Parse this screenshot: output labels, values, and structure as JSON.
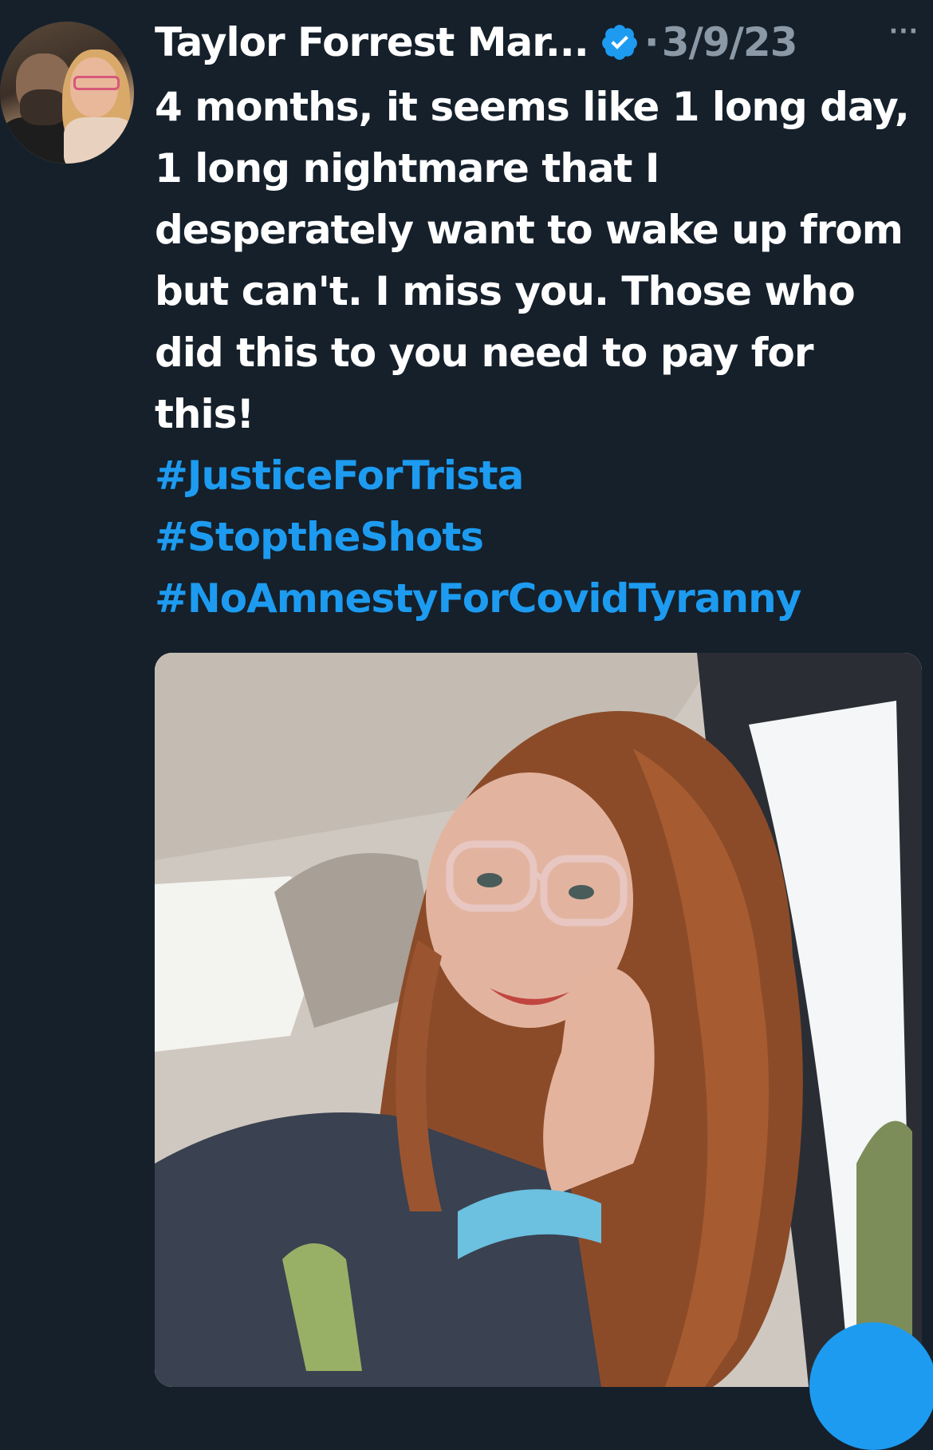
{
  "tweet": {
    "author_name": "Taylor Forrest Mar...",
    "separator": "·",
    "date": "3/9/23",
    "more_label": "···",
    "text": "4 months, it seems like 1 long day, 1 long nightmare that I desperately want to wake up from but can't. I miss you. Those who did this to you need to pay for this!",
    "hashtags": [
      "#JusticeForTrista",
      "#StoptheShots",
      "#NoAmnestyForCovidTyranny"
    ]
  },
  "colors": {
    "background": "#15202b",
    "text": "#ffffff",
    "muted": "#8b98a5",
    "link": "#1d9bf0",
    "verified": "#1d9bf0"
  },
  "icons": {
    "verified": "verified-badge-icon",
    "more": "more-horizontal-icon"
  }
}
